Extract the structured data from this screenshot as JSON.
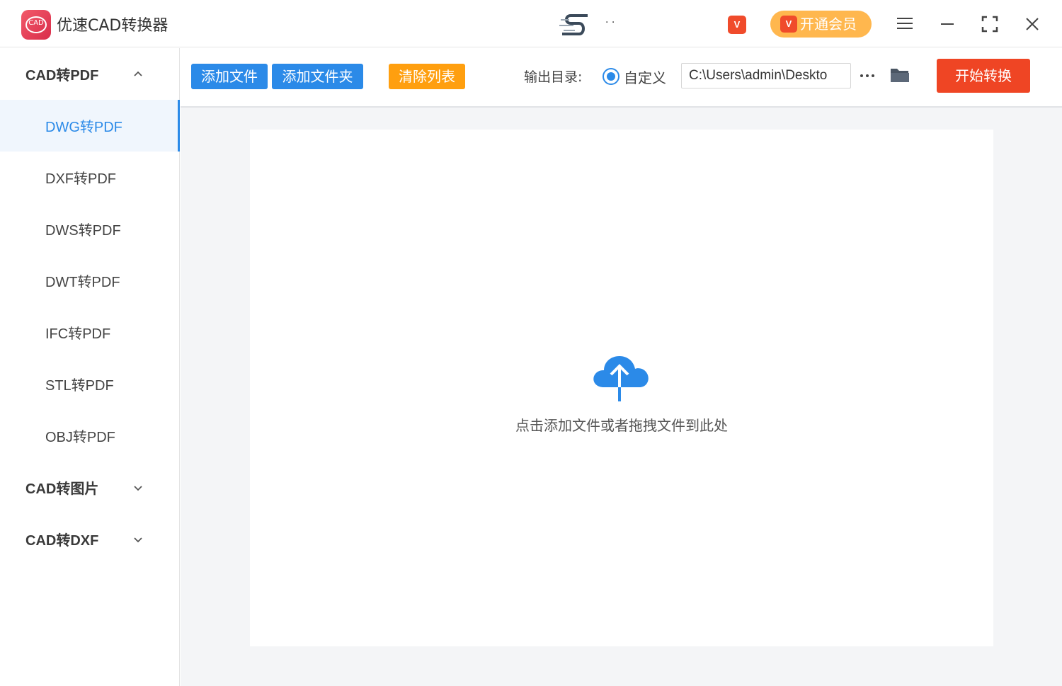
{
  "app": {
    "title": "优速CAD转换器",
    "logo_text": "CAD",
    "user_name": "· ·",
    "vip_badge": "V",
    "vip_button_label": "开通会员"
  },
  "window_controls": {
    "menu": "menu-icon",
    "minimize": "minimize-icon",
    "maximize": "maximize-icon",
    "close": "close-icon"
  },
  "sidebar": {
    "groups": [
      {
        "label": "CAD转PDF",
        "expanded": true,
        "items": [
          {
            "label": "DWG转PDF",
            "active": true
          },
          {
            "label": "DXF转PDF",
            "active": false
          },
          {
            "label": "DWS转PDF",
            "active": false
          },
          {
            "label": "DWT转PDF",
            "active": false
          },
          {
            "label": "IFC转PDF",
            "active": false
          },
          {
            "label": "STL转PDF",
            "active": false
          },
          {
            "label": "OBJ转PDF",
            "active": false
          }
        ]
      },
      {
        "label": "CAD转图片",
        "expanded": false
      },
      {
        "label": "CAD转DXF",
        "expanded": false
      }
    ]
  },
  "toolbar": {
    "add_file": "添加文件",
    "add_folder": "添加文件夹",
    "clear_list": "清除列表",
    "output_label": "输出目录:",
    "output_option": "自定义",
    "output_path": "C:\\Users\\admin\\Deskto",
    "start": "开始转换"
  },
  "dropzone": {
    "hint": "点击添加文件或者拖拽文件到此处"
  },
  "colors": {
    "accent": "#2b8ae8",
    "clear_button": "#ff9f0f",
    "start_button": "#ef4524",
    "vip_button": "#ffb74e",
    "vip_badge": "#f04b2b"
  }
}
